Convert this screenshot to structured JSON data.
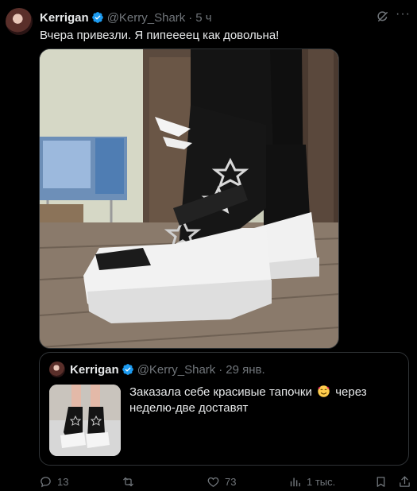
{
  "tweet": {
    "author_name": "Kerrigan",
    "handle": "@Kerry_Shark",
    "separator": "·",
    "time": "5 ч",
    "more_label": "···",
    "text": "Вчера привезли. Я пипеееец как довольна!"
  },
  "quote": {
    "author_name": "Kerrigan",
    "handle": "@Kerry_Shark",
    "separator": "·",
    "date": "29 янв.",
    "text_before": "Заказала себе красивые тапочки",
    "text_after": "через неделю-две доставят"
  },
  "actions": {
    "replies": "13",
    "retweets": "",
    "likes": "73",
    "views": "1 тыс."
  },
  "colors": {
    "background": "#000000",
    "text": "#e7e9ea",
    "muted": "#71767b",
    "verified": "#1d9bf0",
    "border": "#2f3336"
  },
  "icons": [
    "verified-badge-icon",
    "grok-icon",
    "more-icon",
    "reply-icon",
    "retweet-icon",
    "like-icon",
    "views-icon",
    "bookmark-icon",
    "share-icon",
    "smiling-face-with-hearts-emoji"
  ]
}
